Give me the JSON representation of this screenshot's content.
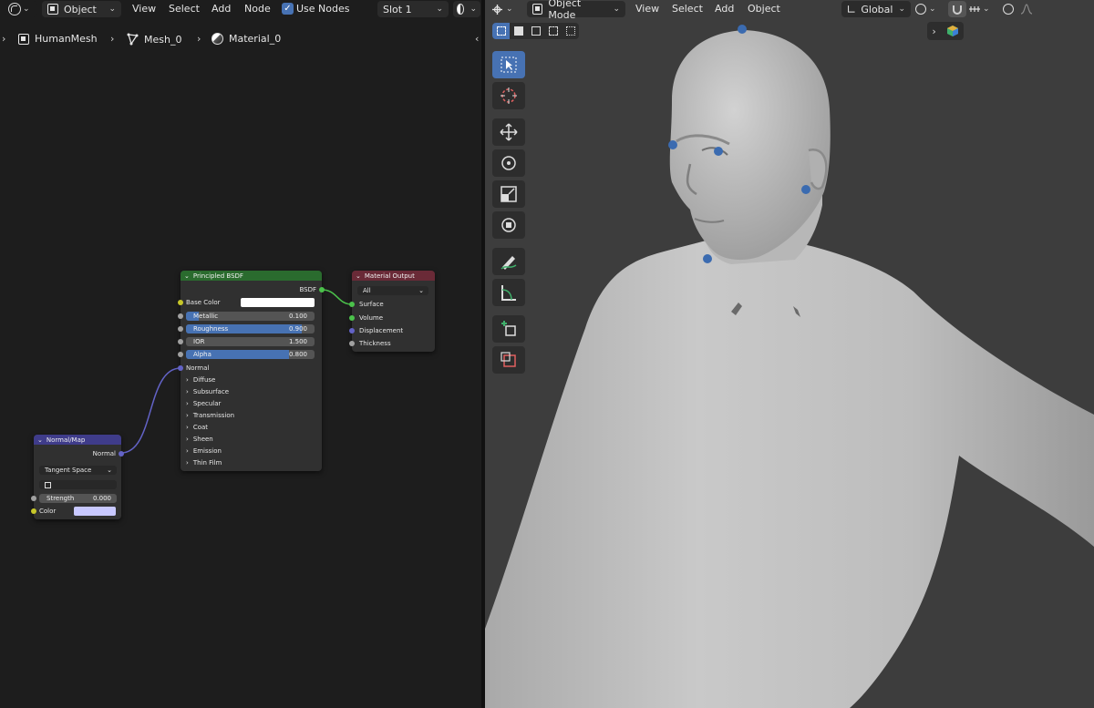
{
  "node_editor": {
    "header": {
      "editor_type_icon": "shader-editor-icon",
      "object_dropdown": "Object",
      "menus": [
        "View",
        "Select",
        "Add",
        "Node"
      ],
      "use_nodes_label": "Use Nodes",
      "use_nodes_checked": true,
      "slot_dropdown": "Slot 1",
      "render_icon": "shading-sphere-icon"
    },
    "breadcrumb": {
      "object": "HumanMesh",
      "mesh": "Mesh_0",
      "material": "Material_0"
    },
    "nodes": {
      "principled": {
        "title": "Principled BSDF",
        "output": "BSDF",
        "base_color_label": "Base Color",
        "base_color": "#ffffff",
        "metallic": {
          "label": "Metallic",
          "value": "0.100",
          "fraction": 0.1
        },
        "roughness": {
          "label": "Roughness",
          "value": "0.900",
          "fraction": 0.9
        },
        "ior": {
          "label": "IOR",
          "value": "1.500"
        },
        "alpha": {
          "label": "Alpha",
          "value": "0.800",
          "fraction": 0.8
        },
        "normal_label": "Normal",
        "panels": [
          "Diffuse",
          "Subsurface",
          "Specular",
          "Transmission",
          "Coat",
          "Sheen",
          "Emission",
          "Thin Film"
        ]
      },
      "material_output": {
        "title": "Material Output",
        "target": "All",
        "inputs": [
          "Surface",
          "Volume",
          "Displacement",
          "Thickness"
        ]
      },
      "normal_map": {
        "title": "Normal/Map",
        "output": "Normal",
        "space": "Tangent Space",
        "strength_label": "Strength",
        "strength_value": "0.000",
        "color_label": "Color",
        "color": "#c8c8ff"
      }
    }
  },
  "viewport": {
    "header": {
      "mode_dropdown": "Object Mode",
      "menus": [
        "View",
        "Select",
        "Add",
        "Object"
      ],
      "orientation_dropdown": "Global"
    },
    "tools": [
      "select-box-icon",
      "cursor-icon",
      "move-icon",
      "rotate-icon",
      "scale-icon",
      "transform-icon",
      "annotate-icon",
      "measure-icon",
      "add-cube-icon",
      "cube-edit-icon"
    ]
  },
  "colors": {
    "accent": "#4772b3",
    "node_bsdf_header": "#2a6b2e",
    "node_output_header": "#6a2a37",
    "node_normal_header": "#3f3c8a",
    "socket_shader": "#4bc24b",
    "socket_vector": "#6363c7",
    "socket_color": "#c7c729",
    "socket_float": "#a1a1a1"
  }
}
